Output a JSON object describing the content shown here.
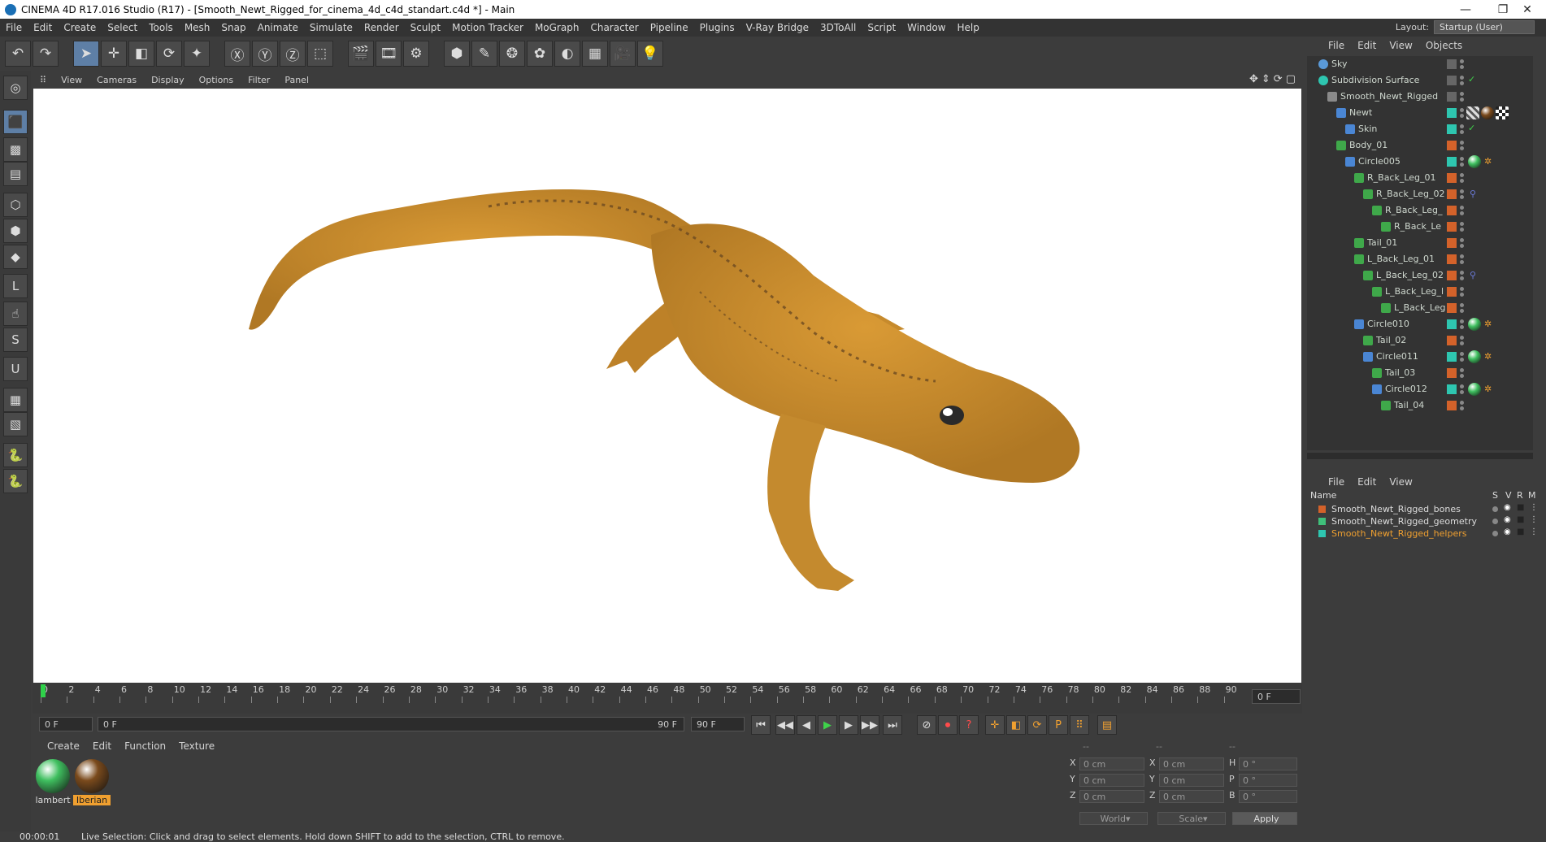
{
  "window": {
    "title": "CINEMA 4D R17.016 Studio (R17) - [Smooth_Newt_Rigged_for_cinema_4d_c4d_standart.c4d *] - Main",
    "controls": [
      "—",
      "❐",
      "✕"
    ]
  },
  "menubar": [
    "File",
    "Edit",
    "Create",
    "Select",
    "Tools",
    "Mesh",
    "Snap",
    "Animate",
    "Simulate",
    "Render",
    "Sculpt",
    "Motion Tracker",
    "MoGraph",
    "Character",
    "Pipeline",
    "Plugins",
    "V-Ray Bridge",
    "3DToAll",
    "Script",
    "Window",
    "Help"
  ],
  "layout": {
    "label": "Layout:",
    "value": "Startup (User)"
  },
  "toolbar": {
    "icons": [
      "undo-icon",
      "redo-icon",
      "live-selection-icon",
      "move-icon",
      "scale-icon",
      "rotate-icon",
      "recent-tool-icon",
      "x-axis-icon",
      "y-axis-icon",
      "z-axis-icon",
      "coordinate-system-icon",
      "render-view-icon",
      "render-picture-viewer-icon",
      "edit-render-settings-icon",
      "cube-icon",
      "pen-spline-icon",
      "subdivision-icon",
      "cloner-icon",
      "deformer-icon",
      "floor-icon",
      "camera-icon",
      "light-icon"
    ],
    "glyphs": [
      "↶",
      "↷",
      "➤",
      "✛",
      "◧",
      "⟳",
      "✦",
      "Ⓧ",
      "Ⓨ",
      "Ⓩ",
      "⬚",
      "🎬",
      "🎞",
      "⚙",
      "⬢",
      "✎",
      "❂",
      "✿",
      "◐",
      "▦",
      "🎥",
      "💡"
    ]
  },
  "lefttools": {
    "icons": [
      "make-editable-icon",
      "model-mode-icon",
      "texture-mode-icon",
      "workplane-icon",
      "points-mode-icon",
      "edges-mode-icon",
      "polygons-mode-icon",
      "axis-mode-icon",
      "tweak-icon",
      "snap-icon",
      "magnet-icon",
      "grid-icon",
      "sculpt-grid-icon",
      "python-icon",
      "python2-icon"
    ],
    "glyphs": [
      "◎",
      "⬛",
      "▩",
      "▤",
      "⬡",
      "⬢",
      "◆",
      "L",
      "☝",
      "S",
      "U",
      "▦",
      "▧",
      "🐍",
      "🐍"
    ]
  },
  "viewport": {
    "menu": [
      "View",
      "Cameras",
      "Display",
      "Options",
      "Filter",
      "Panel"
    ],
    "nav_icons": [
      "move-view-icon",
      "zoom-view-icon",
      "rotate-view-icon",
      "maximize-view-icon"
    ],
    "nav_glyphs": [
      "✥",
      "⇕",
      "⟳",
      "▢"
    ]
  },
  "timeline": {
    "ticks": [
      "0",
      "2",
      "4",
      "6",
      "8",
      "10",
      "12",
      "14",
      "16",
      "18",
      "20",
      "22",
      "24",
      "26",
      "28",
      "30",
      "32",
      "34",
      "36",
      "38",
      "40",
      "42",
      "44",
      "46",
      "48",
      "50",
      "52",
      "54",
      "56",
      "58",
      "60",
      "62",
      "64",
      "66",
      "68",
      "70",
      "72",
      "74",
      "76",
      "78",
      "80",
      "82",
      "84",
      "86",
      "88",
      "90"
    ],
    "current_frame": "0 F"
  },
  "transport": {
    "start_field": "0 F",
    "range_start": "0 F",
    "range_end": "90 F",
    "end_field": "90 F",
    "buttons": [
      "go-to-start-icon",
      "previous-key-icon",
      "previous-frame-icon",
      "play-icon",
      "next-frame-icon",
      "next-key-icon",
      "go-to-end-icon"
    ],
    "glyphs": [
      "⏮",
      "◀◀",
      "◀",
      "▶",
      "▶",
      "▶▶",
      "⏭"
    ],
    "record_buttons": [
      "record-disabled-icon",
      "autokey-icon",
      "keyframe-selection-icon"
    ],
    "record_glyphs": [
      "⊘",
      "⏺",
      "?"
    ],
    "key_buttons": [
      "key-position-icon",
      "key-scale-icon",
      "key-rotation-icon",
      "key-parameter-icon",
      "key-pla-icon",
      "timeline-window-icon"
    ],
    "key_glyphs": [
      "✛",
      "◧",
      "⟳",
      "P",
      "⠿",
      "▤"
    ]
  },
  "material_panel": {
    "menu": [
      "Create",
      "Edit",
      "Function",
      "Texture"
    ],
    "materials": [
      {
        "name": "lambert",
        "color": "#3fbf5f",
        "selected": false
      },
      {
        "name": "Iberian",
        "color": "#7a4a1c",
        "selected": true
      }
    ]
  },
  "coord_panel": {
    "headers": [
      "--",
      "--",
      "--"
    ],
    "rows": [
      {
        "axis": "X",
        "pos": "0 cm",
        "size_axis": "X",
        "size": "0 cm",
        "rot_axis": "H",
        "rot": "0 °"
      },
      {
        "axis": "Y",
        "pos": "0 cm",
        "size_axis": "Y",
        "size": "0 cm",
        "rot_axis": "P",
        "rot": "0 °"
      },
      {
        "axis": "Z",
        "pos": "0 cm",
        "size_axis": "Z",
        "size": "0 cm",
        "rot_axis": "B",
        "rot": "0 °"
      }
    ],
    "space": "World",
    "mode": "Scale",
    "apply": "Apply"
  },
  "object_manager": {
    "menu": [
      "File",
      "Edit",
      "View",
      "Objects"
    ],
    "objects": [
      {
        "name": "Sky",
        "indent": 0,
        "icon": "sky-icon",
        "tag": ""
      },
      {
        "name": "Subdivision Surface",
        "indent": 0,
        "icon": "subdivision-icon",
        "tag": "check"
      },
      {
        "name": "Smooth_Newt_Rigged",
        "indent": 1,
        "icon": "null-icon",
        "tag": ""
      },
      {
        "name": "Newt",
        "indent": 2,
        "icon": "polygon-icon",
        "tag": "materials"
      },
      {
        "name": "Skin",
        "indent": 3,
        "icon": "skin-icon",
        "tag": "check"
      },
      {
        "name": "Body_01",
        "indent": 2,
        "icon": "joint-icon",
        "tag": ""
      },
      {
        "name": "Circle005",
        "indent": 3,
        "icon": "spline-icon",
        "tag": "ball"
      },
      {
        "name": "R_Back_Leg_01",
        "indent": 4,
        "icon": "joint-icon",
        "tag": ""
      },
      {
        "name": "R_Back_Leg_02",
        "indent": 5,
        "icon": "joint-icon",
        "tag": "ik"
      },
      {
        "name": "R_Back_Leg_",
        "indent": 6,
        "icon": "joint-icon",
        "tag": ""
      },
      {
        "name": "R_Back_Le",
        "indent": 7,
        "icon": "joint-icon",
        "tag": ""
      },
      {
        "name": "Tail_01",
        "indent": 4,
        "icon": "joint-icon",
        "tag": ""
      },
      {
        "name": "L_Back_Leg_01",
        "indent": 4,
        "icon": "joint-icon",
        "tag": ""
      },
      {
        "name": "L_Back_Leg_02",
        "indent": 5,
        "icon": "joint-icon",
        "tag": "ik"
      },
      {
        "name": "L_Back_Leg_l",
        "indent": 6,
        "icon": "joint-icon",
        "tag": ""
      },
      {
        "name": "L_Back_Leg",
        "indent": 7,
        "icon": "joint-icon",
        "tag": ""
      },
      {
        "name": "Circle010",
        "indent": 4,
        "icon": "spline-icon",
        "tag": "ball"
      },
      {
        "name": "Tail_02",
        "indent": 5,
        "icon": "joint-icon",
        "tag": ""
      },
      {
        "name": "Circle011",
        "indent": 5,
        "icon": "spline-icon",
        "tag": "ball"
      },
      {
        "name": "Tail_03",
        "indent": 6,
        "icon": "joint-icon",
        "tag": ""
      },
      {
        "name": "Circle012",
        "indent": 6,
        "icon": "spline-icon",
        "tag": "ball"
      },
      {
        "name": "Tail_04",
        "indent": 7,
        "icon": "joint-icon",
        "tag": ""
      }
    ]
  },
  "layer_manager": {
    "menu": [
      "File",
      "Edit",
      "View"
    ],
    "columns": [
      "Name",
      "S",
      "V",
      "R",
      "M"
    ],
    "layers": [
      {
        "name": "Smooth_Newt_Rigged_bones",
        "color": "#d4622a",
        "active": false
      },
      {
        "name": "Smooth_Newt_Rigged_geometry",
        "color": "#3fbf7a",
        "active": false
      },
      {
        "name": "Smooth_Newt_Rigged_helpers",
        "color": "#2ec6b0",
        "active": true
      }
    ]
  },
  "status": {
    "time": "00:00:01",
    "message": "Live Selection: Click and drag to select elements. Hold down SHIFT to add to the selection, CTRL to remove."
  },
  "colors": {
    "newt_body": "#c98c2a",
    "newt_dark": "#9a6418",
    "selection_accent": "#f0a030",
    "ui_background": "#3c3c3c"
  }
}
